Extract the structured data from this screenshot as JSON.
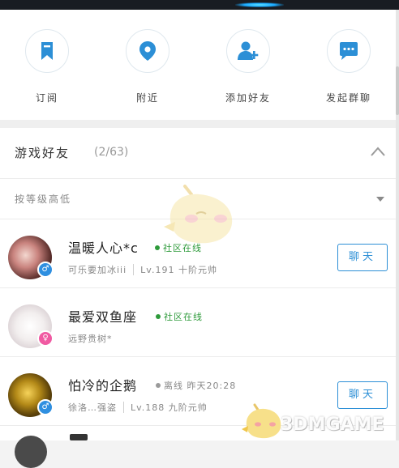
{
  "quick_actions": [
    {
      "label": "订阅",
      "icon": "bookmark-icon"
    },
    {
      "label": "附近",
      "icon": "location-pin-icon"
    },
    {
      "label": "添加好友",
      "icon": "add-friend-icon"
    },
    {
      "label": "发起群聊",
      "icon": "group-chat-icon"
    }
  ],
  "group": {
    "title": "游戏好友",
    "count": "(2/63)"
  },
  "sort": {
    "label": "按等级高低"
  },
  "friends": [
    {
      "name": "温暖人心*c",
      "status": "社区在线",
      "gender": "male",
      "gender_symbol": "♂",
      "sub_left": "可乐要加冰iii",
      "sub_right": "Lv.191  十阶元帅",
      "chat_label": "聊天"
    },
    {
      "name": "最爱双鱼座",
      "status": "社区在线",
      "gender": "female",
      "gender_symbol": "♀",
      "sub_left": "远野贵树*"
    },
    {
      "name": "怕冷的企鹅",
      "status": "离线  昨天20:28",
      "gender": "male",
      "gender_symbol": "♂",
      "sub_left": "徐洛…强盗",
      "sub_right": "Lv.188  九阶元帅",
      "chat_label": "聊天"
    }
  ],
  "watermark": {
    "text": "3DMGAME"
  },
  "colors": {
    "accent": "#2c8fd6",
    "online": "#2d9a3a",
    "offline": "#888888",
    "male": "#2f8fe0",
    "female": "#f05aa2"
  }
}
